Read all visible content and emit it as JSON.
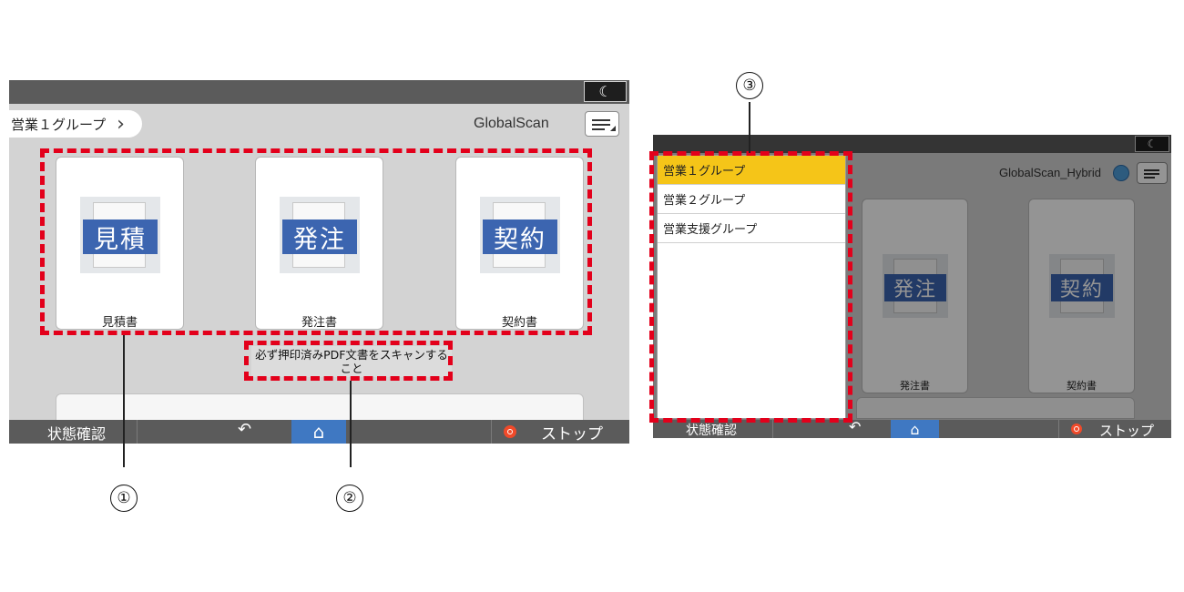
{
  "left_screen": {
    "group_button": "営業１グループ",
    "group_chevron": "›",
    "app_title": "GlobalScan",
    "moon_glyph": "☾",
    "cards": [
      {
        "thumb_text": "見積",
        "label": "見積書"
      },
      {
        "thumb_text": "発注",
        "label": "発注書"
      },
      {
        "thumb_text": "契約",
        "label": "契約書"
      }
    ],
    "message": "必ず押印済みPDF文書をスキャンすること",
    "bottom": {
      "status": "状態確認",
      "back_glyph": "↶",
      "home_glyph": "⌂",
      "stop": "ストップ"
    }
  },
  "right_screen": {
    "app_title": "GlobalScan_Hybrid",
    "moon_glyph": "☾",
    "dropdown_items": [
      {
        "label": "営業１グループ",
        "selected": true
      },
      {
        "label": "営業２グループ",
        "selected": false
      },
      {
        "label": "営業支援グループ",
        "selected": false
      }
    ],
    "cards": [
      {
        "thumb_text": "発注",
        "label": "発注書"
      },
      {
        "thumb_text": "契約",
        "label": "契約書"
      }
    ],
    "bottom": {
      "status": "状態確認",
      "back_glyph": "↶",
      "home_glyph": "⌂",
      "stop": "ストップ"
    }
  },
  "callouts": [
    "①",
    "②",
    "③"
  ],
  "colors": {
    "highlight": "#e3001b",
    "selected": "#f5c518",
    "accent": "#3f78c2",
    "band": "#3c65b0"
  }
}
